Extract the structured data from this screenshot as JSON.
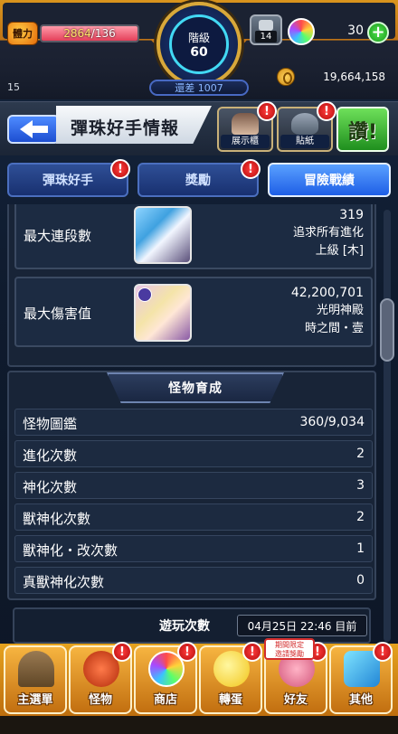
{
  "hud": {
    "stamina_label": "體力",
    "stamina_current": "2864",
    "stamina_max": "/136",
    "rank_title": "階級",
    "rank_value": "60",
    "exp_remaining": "還差 1007",
    "box_count": "14",
    "orb_count": "30",
    "left_number": "15",
    "coin_count": "19,664,158"
  },
  "title": {
    "text": "彈珠好手情報",
    "icons": [
      {
        "label": "展示櫃"
      },
      {
        "label": "貼紙"
      },
      {
        "label": "讚!"
      }
    ]
  },
  "tabs": [
    {
      "label": "彈珠好手",
      "active": false,
      "alert": "!"
    },
    {
      "label": "獎勵",
      "active": false,
      "alert": "!"
    },
    {
      "label": "冒險戰績",
      "active": true
    }
  ],
  "records": [
    {
      "label": "最大連段數",
      "lines": [
        "319",
        "追求所有進化",
        "上級 [木]"
      ]
    },
    {
      "label": "最大傷害值",
      "lines": [
        "42,200,701",
        "光明神殿",
        "時之間・壹"
      ]
    }
  ],
  "monster_section": {
    "title": "怪物育成",
    "rows": [
      {
        "key": "怪物圖鑑",
        "value": "360/9,034"
      },
      {
        "key": "進化次數",
        "value": "2"
      },
      {
        "key": "神化次數",
        "value": "3"
      },
      {
        "key": "獸神化次數",
        "value": "2"
      },
      {
        "key": "獸神化・改次數",
        "value": "1"
      },
      {
        "key": "真獸神化次數",
        "value": "0"
      }
    ]
  },
  "play_section": {
    "title": "遊玩次數",
    "date": "04月25日 22:46 目前"
  },
  "nav": [
    {
      "label": "主選單"
    },
    {
      "label": "怪物",
      "alert": "!"
    },
    {
      "label": "商店",
      "alert": "!"
    },
    {
      "label": "轉蛋",
      "alert": "!"
    },
    {
      "label": "好友",
      "alert": "!",
      "promo": "期間限定\n邀請獎勵"
    },
    {
      "label": "其他",
      "alert": "!"
    }
  ],
  "colors": {
    "accent": "#1e5ee6",
    "alert": "#e02020",
    "hud_gold": "#e29a1c",
    "panel_bg": "#182437"
  },
  "stamina_fill_fraction": 1.0
}
